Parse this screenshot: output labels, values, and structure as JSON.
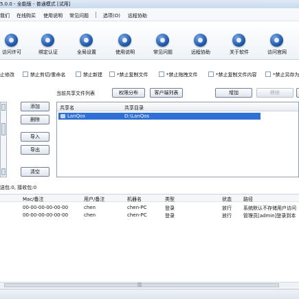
{
  "title": "5.0.0 - 全能版 - 普通模式 [试用]",
  "menu": [
    {
      "label": "我们"
    },
    {
      "label": "在线购买"
    },
    {
      "label": "使用说明"
    },
    {
      "label": "常见问题"
    },
    {
      "label": "选项(O)"
    },
    {
      "label": "远程协助"
    }
  ],
  "toolbar": [
    {
      "label": "访问许可",
      "icon": "key-icon"
    },
    {
      "label": "绑定认证",
      "icon": "certificate-icon"
    },
    {
      "label": "全局设置",
      "icon": "gear-icon"
    },
    {
      "label": "使用说明",
      "icon": "book-icon"
    },
    {
      "label": "常见问题",
      "icon": "help-icon"
    },
    {
      "label": "远程协助",
      "icon": "remote-icon"
    },
    {
      "label": "关于软件",
      "icon": "info-icon"
    },
    {
      "label": "访问官网",
      "icon": "globe-icon"
    }
  ],
  "options": [
    {
      "label": "止修改"
    },
    {
      "label": "禁止剪切/重命名"
    },
    {
      "label": "禁止新建"
    },
    {
      "label": "*禁止复制文件"
    },
    {
      "label": "*禁止拖拽文件"
    },
    {
      "label": "*禁止复制文件内容"
    },
    {
      "label": "*禁止另存为"
    }
  ],
  "share": {
    "list_label": "当前共享文件列表",
    "btn_perm": "权限分布",
    "btn_client": "客户端列表",
    "btn_add_right": "增加",
    "btn_remove_right": "移除",
    "col_name": "共享名",
    "col_dir": "共享目录",
    "rows": [
      {
        "name": "LanQos",
        "dir": "D:\\LanQos"
      }
    ]
  },
  "side_buttons": {
    "add": "添加",
    "delete": "删除",
    "import": "导入",
    "export": "导出",
    "clear": "清空"
  },
  "stats": "送包:0, 接收包:0",
  "log": {
    "headers": [
      "Mac/备注",
      "用户/备注",
      "机器名",
      "类型",
      "状态",
      "路径"
    ],
    "rows": [
      {
        "mac": "00-00-00-00-00-00",
        "user": "chen",
        "machine": "chen-PC",
        "type": "登录",
        "status": "放行",
        "path": "系统默认不存储用户访问"
      },
      {
        "mac": "00-00-00-00-00-00",
        "user": "chen",
        "machine": "chen-PC",
        "type": "登录",
        "status": "放行",
        "path": "管理员[admin]登录到本"
      }
    ]
  },
  "scroll_grip": "|||"
}
